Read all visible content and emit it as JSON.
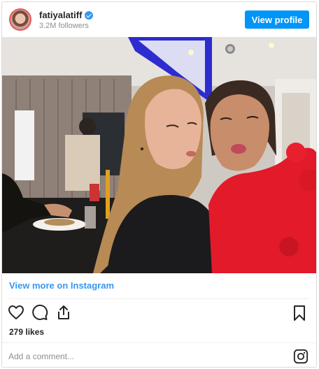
{
  "header": {
    "username": "fatiyalatiff",
    "followers": "3.2M followers",
    "view_profile_label": "View profile"
  },
  "post": {
    "view_more_label": "View more on Instagram",
    "likes": "279 likes",
    "comment_placeholder": "Add a comment..."
  },
  "icons": {
    "like": "heart-icon",
    "comment": "comment-icon",
    "share": "share-icon",
    "save": "bookmark-icon",
    "instagram": "instagram-logo-icon",
    "verified": "verified-badge-icon"
  },
  "colors": {
    "accent": "#0095f6",
    "link": "#3897f0",
    "text": "#262626",
    "muted": "#8e8e8e"
  }
}
